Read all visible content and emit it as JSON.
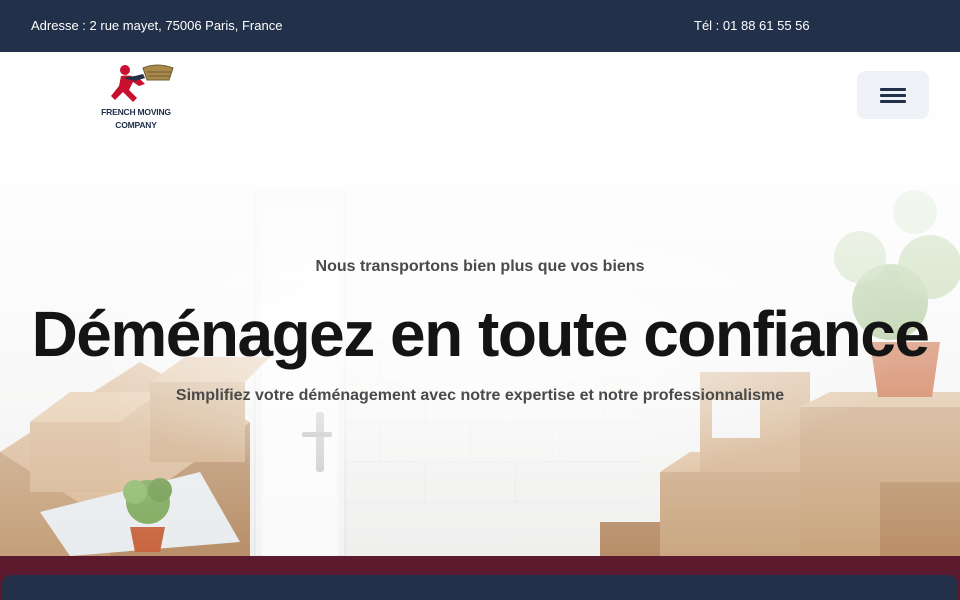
{
  "topbar": {
    "address_icon": "map-marker-icon",
    "address": "Adresse : 2 rue mayet, 75006 Paris, France",
    "phone": "Tél : 01 88 61 55 56"
  },
  "logo": {
    "line1": "FRENCH MOVING",
    "line2": "COMPANY"
  },
  "menu": {
    "icon": "hamburger-icon"
  },
  "hero": {
    "tagline": "Nous transportons bien plus que vos biens",
    "title": "Déménagez en toute confiance",
    "subtitle": "Simplifiez votre déménagement avec notre expertise et notre professionnalisme"
  },
  "colors": {
    "navy": "#233049",
    "burgundy": "#5c1a2e",
    "logo_red": "#c8102e"
  }
}
